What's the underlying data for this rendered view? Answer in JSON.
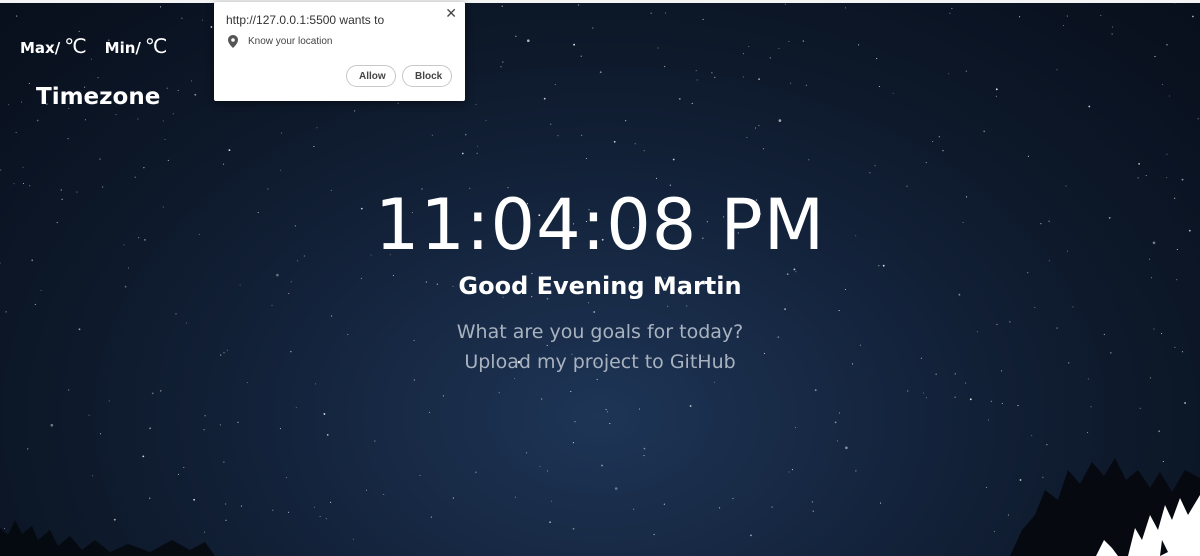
{
  "weather": {
    "max_label": "Max/",
    "min_label": "Min/",
    "unit": "℃"
  },
  "timezone": "Timezone",
  "clock": "11:04:08 PM",
  "greeting": "Good Evening Martin",
  "focus": {
    "question": "What are you goals for today?",
    "answer": "Upload my project to GitHub"
  },
  "permission_popup": {
    "title": "http://127.0.0.1:5500 wants to",
    "permission": "Know your location",
    "allow_label": "Allow",
    "block_label": "Block",
    "close_glyph": "✕",
    "icons": [
      "location-pin-icon",
      "close-icon"
    ]
  },
  "colors": {
    "sky": "#0d1829",
    "text": "#ffffff",
    "muted_text": "#a9b2bf"
  }
}
